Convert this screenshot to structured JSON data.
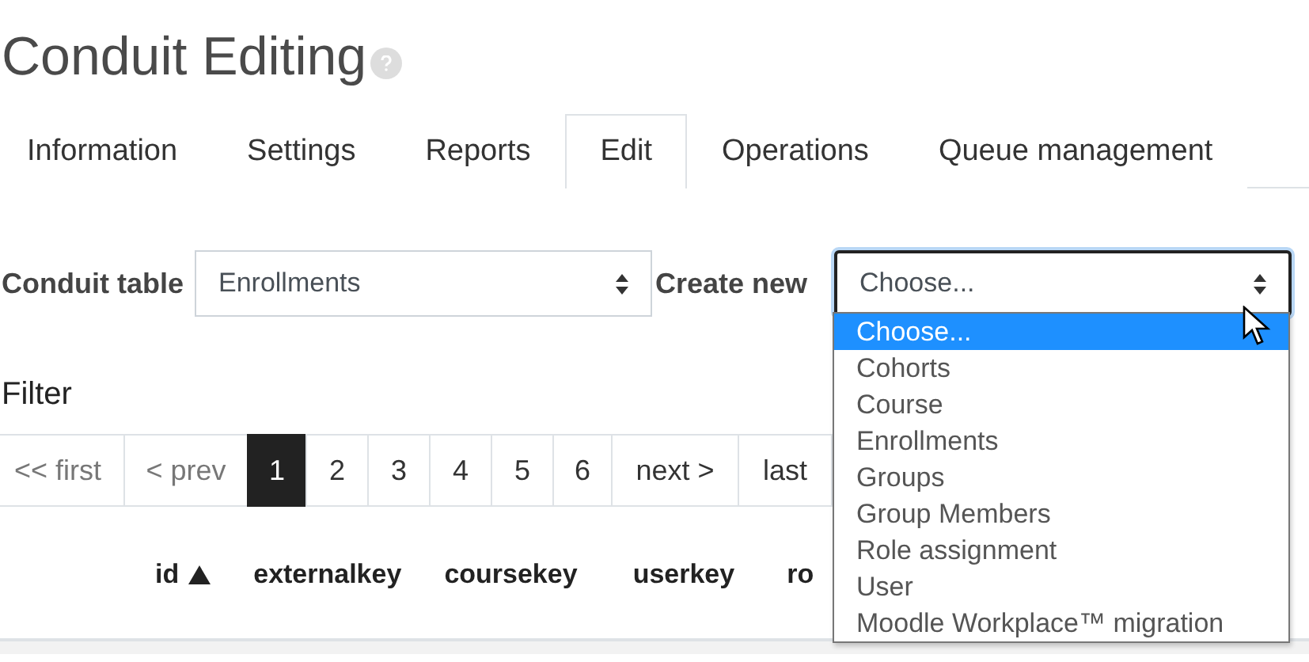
{
  "page": {
    "title": "Conduit Editing"
  },
  "tabs": [
    {
      "label": "Information",
      "selected": false
    },
    {
      "label": "Settings",
      "selected": false
    },
    {
      "label": "Reports",
      "selected": false
    },
    {
      "label": "Edit",
      "selected": true
    },
    {
      "label": "Operations",
      "selected": false
    },
    {
      "label": "Queue management",
      "selected": false
    }
  ],
  "form": {
    "table_label": "Conduit table",
    "table_value": "Enrollments",
    "create_label": "Create new",
    "create_value": "Choose...",
    "create_expanded": true,
    "create_options": [
      {
        "label": "Choose...",
        "selected": true
      },
      {
        "label": "Cohorts",
        "selected": false
      },
      {
        "label": "Course",
        "selected": false
      },
      {
        "label": "Enrollments",
        "selected": false
      },
      {
        "label": "Groups",
        "selected": false
      },
      {
        "label": "Group Members",
        "selected": false
      },
      {
        "label": "Role assignment",
        "selected": false
      },
      {
        "label": "User",
        "selected": false
      },
      {
        "label": "Moodle Workplace™ migration",
        "selected": false
      }
    ]
  },
  "filter": {
    "label": "Filter"
  },
  "pagination": [
    {
      "label": "<< first",
      "selected": false,
      "disabled": true
    },
    {
      "label": "< prev",
      "selected": false,
      "disabled": true
    },
    {
      "label": "1",
      "selected": true,
      "disabled": false
    },
    {
      "label": "2",
      "selected": false,
      "disabled": false
    },
    {
      "label": "3",
      "selected": false,
      "disabled": false
    },
    {
      "label": "4",
      "selected": false,
      "disabled": false
    },
    {
      "label": "5",
      "selected": false,
      "disabled": false
    },
    {
      "label": "6",
      "selected": false,
      "disabled": false
    },
    {
      "label": "next >",
      "selected": false,
      "disabled": false
    },
    {
      "label": "last",
      "selected": false,
      "disabled": false
    }
  ],
  "table": {
    "columns": [
      {
        "label": "id",
        "sorted": true
      },
      {
        "label": "externalkey",
        "sorted": false
      },
      {
        "label": "coursekey",
        "sorted": false
      },
      {
        "label": "userkey",
        "sorted": false
      },
      {
        "label": "ro",
        "sorted": false
      }
    ]
  }
}
